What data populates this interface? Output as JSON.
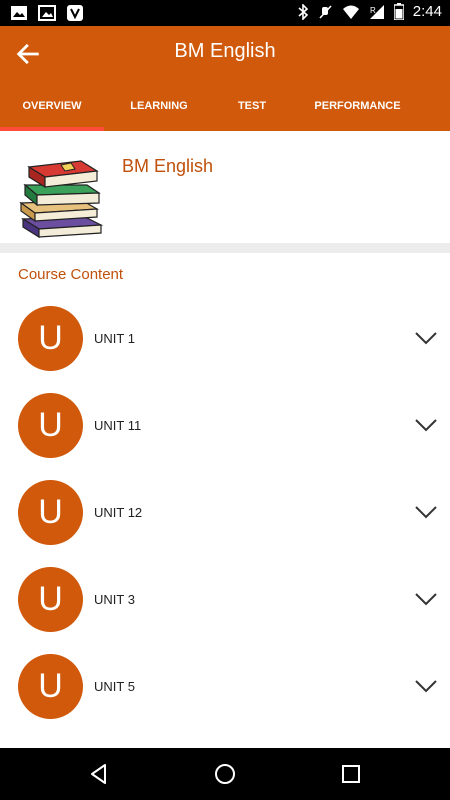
{
  "status_bar": {
    "time": "2:44",
    "icons": [
      "gallery-icon",
      "image-icon",
      "app-v-icon",
      "bluetooth-icon",
      "mute-icon",
      "wifi-icon",
      "signal-icon",
      "battery-icon"
    ],
    "roaming": "R"
  },
  "app_bar": {
    "title": "BM English",
    "back_icon": "arrow-left-icon",
    "color": "#d0590b"
  },
  "tabs": [
    {
      "label": "OVERVIEW",
      "active": true
    },
    {
      "label": "LEARNING",
      "active": false
    },
    {
      "label": "TEST",
      "active": false
    },
    {
      "label": "PERFORMANCE",
      "active": false
    }
  ],
  "course": {
    "name": "BM English",
    "image_icon": "books-icon"
  },
  "content": {
    "section_title": "Course Content",
    "units": [
      {
        "avatar_letter": "U",
        "label": "UNIT 1"
      },
      {
        "avatar_letter": "U",
        "label": "UNIT 11"
      },
      {
        "avatar_letter": "U",
        "label": "UNIT 12"
      },
      {
        "avatar_letter": "U",
        "label": "UNIT 3"
      },
      {
        "avatar_letter": "U",
        "label": "UNIT 5"
      }
    ]
  },
  "nav_bar": {
    "buttons": [
      "back-triangle-icon",
      "home-circle-icon",
      "recents-square-icon"
    ]
  }
}
